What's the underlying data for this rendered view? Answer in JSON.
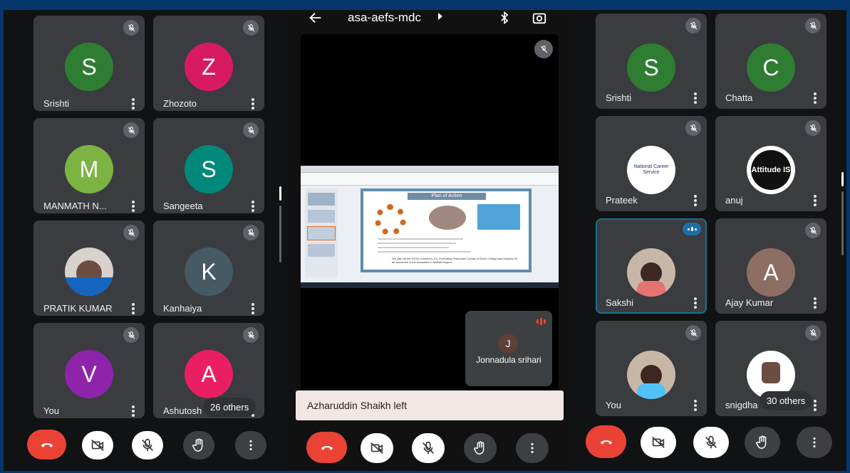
{
  "left_panel": {
    "participants": [
      {
        "name": "Srishti",
        "initial": "S",
        "color": "#2e7d32"
      },
      {
        "name": "Zhozoto",
        "initial": "Z",
        "color": "#d81b60"
      },
      {
        "name": "MANMATH N...",
        "initial": "M",
        "color": "#7cb342"
      },
      {
        "name": "Sangeeta",
        "initial": "S",
        "color": "#00897b"
      },
      {
        "name": "PRATIK KUMAR",
        "initial": "",
        "color": "#d8d2cc"
      },
      {
        "name": "Kanhaiya",
        "initial": "K",
        "color": "#455a64"
      },
      {
        "name": "You",
        "initial": "V",
        "color": "#8e24aa"
      },
      {
        "name": "Ashutosh",
        "initial": "A",
        "color": "#e91e63"
      }
    ],
    "others_label": "26 others"
  },
  "center_panel": {
    "meeting_code": "asa-aefs-mdc",
    "slide_title": "Plan of Action",
    "slide_footer": "We plan all the HODs combined, Ex: Ordinating Placement Camps of Each College and Industry for all vacancies in the Industries in Nalhati Region.",
    "presenter_tile": {
      "initial": "J",
      "name": "Jonnadula srihari"
    },
    "toast": "Azharuddin Shaikh left"
  },
  "right_panel": {
    "participants": [
      {
        "name": "Srishti",
        "initial": "S",
        "color": "#2e7d32"
      },
      {
        "name": "Chatta",
        "initial": "C",
        "color": "#2e7d32"
      },
      {
        "name": "Prateek",
        "initial": "",
        "color": "#ffffff"
      },
      {
        "name": "anuj",
        "initial": "",
        "color": "#ffffff"
      },
      {
        "name": "Sakshi",
        "initial": "",
        "color": "#c8b7a6"
      },
      {
        "name": "Ajay Kumar",
        "initial": "A",
        "color": "#8d6e63"
      },
      {
        "name": "You",
        "initial": "",
        "color": "#c8b7a6"
      },
      {
        "name": "snigdha",
        "initial": "",
        "color": "#ffffff"
      }
    ],
    "prateek_logo_text": "National Career Service",
    "anuj_logo_text": "Attitude IS",
    "others_label": "30 others"
  },
  "icons": [
    "hang-up-icon",
    "camera-off-icon",
    "mic-off-icon",
    "raise-hand-icon",
    "more-icon",
    "back-arrow-icon",
    "bluetooth-icon",
    "flip-camera-icon"
  ]
}
